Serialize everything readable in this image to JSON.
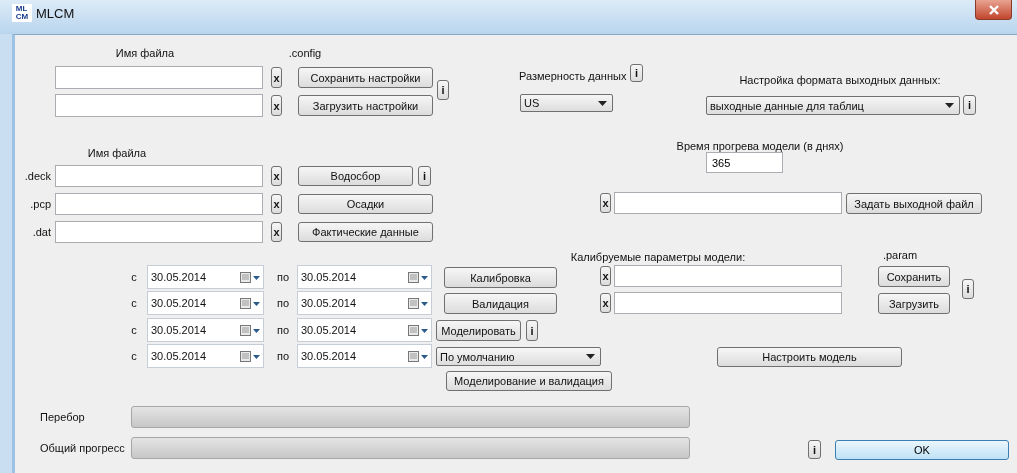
{
  "window": {
    "title": "MLCM",
    "icon_lines": [
      "ML",
      "CM"
    ]
  },
  "settings": {
    "file_label": "Имя файла",
    "ext_label": ".config",
    "info": "i",
    "rows": [
      {
        "value": "",
        "clear": "x",
        "button": "Сохранить настройки"
      },
      {
        "value": "",
        "clear": "x",
        "button": "Загрузить настройки"
      }
    ]
  },
  "dimension": {
    "label": "Размерность данных",
    "info": "i",
    "value": "US"
  },
  "output_format": {
    "label": "Настройка формата выходных данных:",
    "value": "выходные данные для таблиц",
    "info": "i"
  },
  "warmup": {
    "label": "Время прогрева модели (в днях)",
    "value": "365"
  },
  "inputs": {
    "file_label": "Имя файла",
    "rows": [
      {
        "ext": ".deck",
        "clear": "x",
        "button": "Водосбор",
        "info": "i"
      },
      {
        "ext": ".pcp",
        "clear": "x",
        "button": "Осадки"
      },
      {
        "ext": ".dat",
        "clear": "x",
        "button": "Фактические данные"
      }
    ]
  },
  "output_file": {
    "clear": "x",
    "button": "Задать выходной файл"
  },
  "periods": [
    {
      "from_label": "с",
      "from": "30.05.2014",
      "to_label": "по",
      "to": "30.05.2014",
      "action": {
        "kind": "button",
        "label": "Калибровка"
      }
    },
    {
      "from_label": "с",
      "from": "30.05.2014",
      "to_label": "по",
      "to": "30.05.2014",
      "action": {
        "kind": "button",
        "label": "Валидация"
      }
    },
    {
      "from_label": "с",
      "from": "30.05.2014",
      "to_label": "по",
      "to": "30.05.2014",
      "action": {
        "kind": "button",
        "label": "Моделировать",
        "info": "i"
      }
    },
    {
      "from_label": "с",
      "from": "30.05.2014",
      "to_label": "по",
      "to": "30.05.2014",
      "action": {
        "kind": "dropdown",
        "label": "По умолчанию"
      }
    }
  ],
  "simulate_validate": "Моделирование и валидация",
  "params": {
    "label": "Калибруемые параметры модели:",
    "ext_label": ".param",
    "info": "i",
    "rows": [
      {
        "clear": "x",
        "button": "Сохранить"
      },
      {
        "clear": "x",
        "button": "Загрузить"
      }
    ]
  },
  "configure_model": "Настроить модель",
  "progress": [
    {
      "label": "Перебор",
      "level": 0
    },
    {
      "label": "Общий прогресс",
      "level": 0
    }
  ],
  "footer": {
    "info": "i",
    "ok": "OK"
  }
}
